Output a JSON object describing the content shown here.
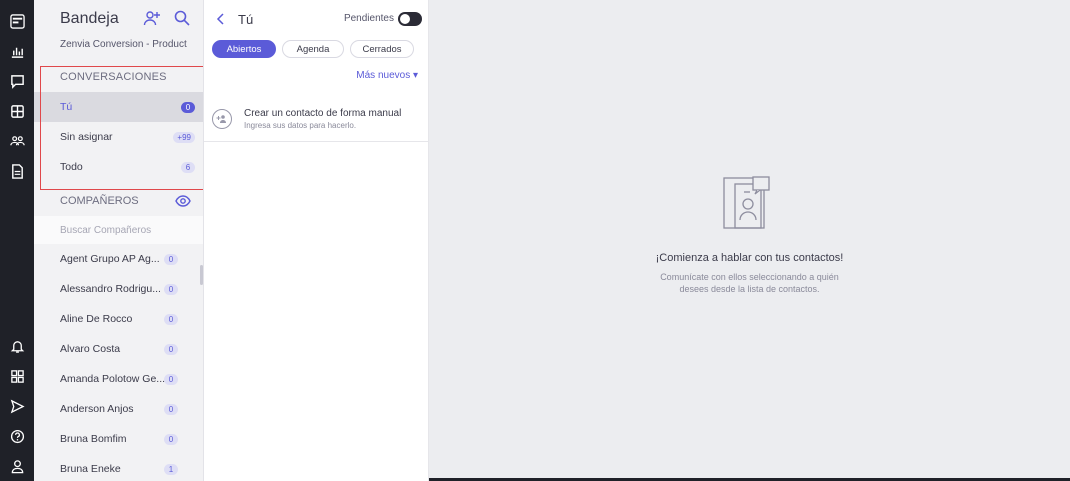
{
  "rail": {
    "top_icons": [
      "zenvia-logo-icon",
      "bar-chart-icon",
      "chat-icon",
      "grid-icon",
      "team-icon",
      "document-icon"
    ],
    "bottom_icons": [
      "bell-icon",
      "apps-icon",
      "send-icon",
      "help-icon",
      "user-icon"
    ]
  },
  "inbox": {
    "title": "Bandeja",
    "org": "Zenvia Conversion - Product",
    "conversations": {
      "header": "CONVERSACIONES",
      "items": [
        {
          "label": "Tú",
          "count": "0",
          "active": true
        },
        {
          "label": "Sin asignar",
          "count": "+99"
        },
        {
          "label": "Todo",
          "count": "6"
        }
      ]
    },
    "companions": {
      "header": "COMPAÑEROS",
      "search_placeholder": "Buscar Compañeros",
      "items": [
        {
          "name": "Agent Grupo AP Ag...",
          "count": "0"
        },
        {
          "name": "Alessandro Rodrigu...",
          "count": "0"
        },
        {
          "name": "Aline De Rocco",
          "count": "0"
        },
        {
          "name": "Alvaro Costa",
          "count": "0"
        },
        {
          "name": "Amanda Polotow Ge...",
          "count": "0"
        },
        {
          "name": "Anderson Anjos",
          "count": "0"
        },
        {
          "name": "Bruna Bomfim",
          "count": "0"
        },
        {
          "name": "Bruna Eneke",
          "count": "1"
        }
      ]
    }
  },
  "list": {
    "title": "Tú",
    "pending_label": "Pendientes",
    "tabs": [
      {
        "label": "Abiertos",
        "active": true
      },
      {
        "label": "Agenda"
      },
      {
        "label": "Cerrados"
      }
    ],
    "sort_label": "Más nuevos ▾",
    "create": {
      "title": "Crear un contacto de forma manual",
      "subtitle": "Ingresa sus datos para hacerlo."
    }
  },
  "empty": {
    "title": "¡Comienza a hablar con tus contactos!",
    "subtitle_line1": "Comunícate con ellos seleccionando a quién",
    "subtitle_line2": "desees desde la lista de contactos."
  },
  "colors": {
    "accent": "#5b5bd8",
    "rail": "#1f2128",
    "highlight_border": "#e0484b"
  }
}
